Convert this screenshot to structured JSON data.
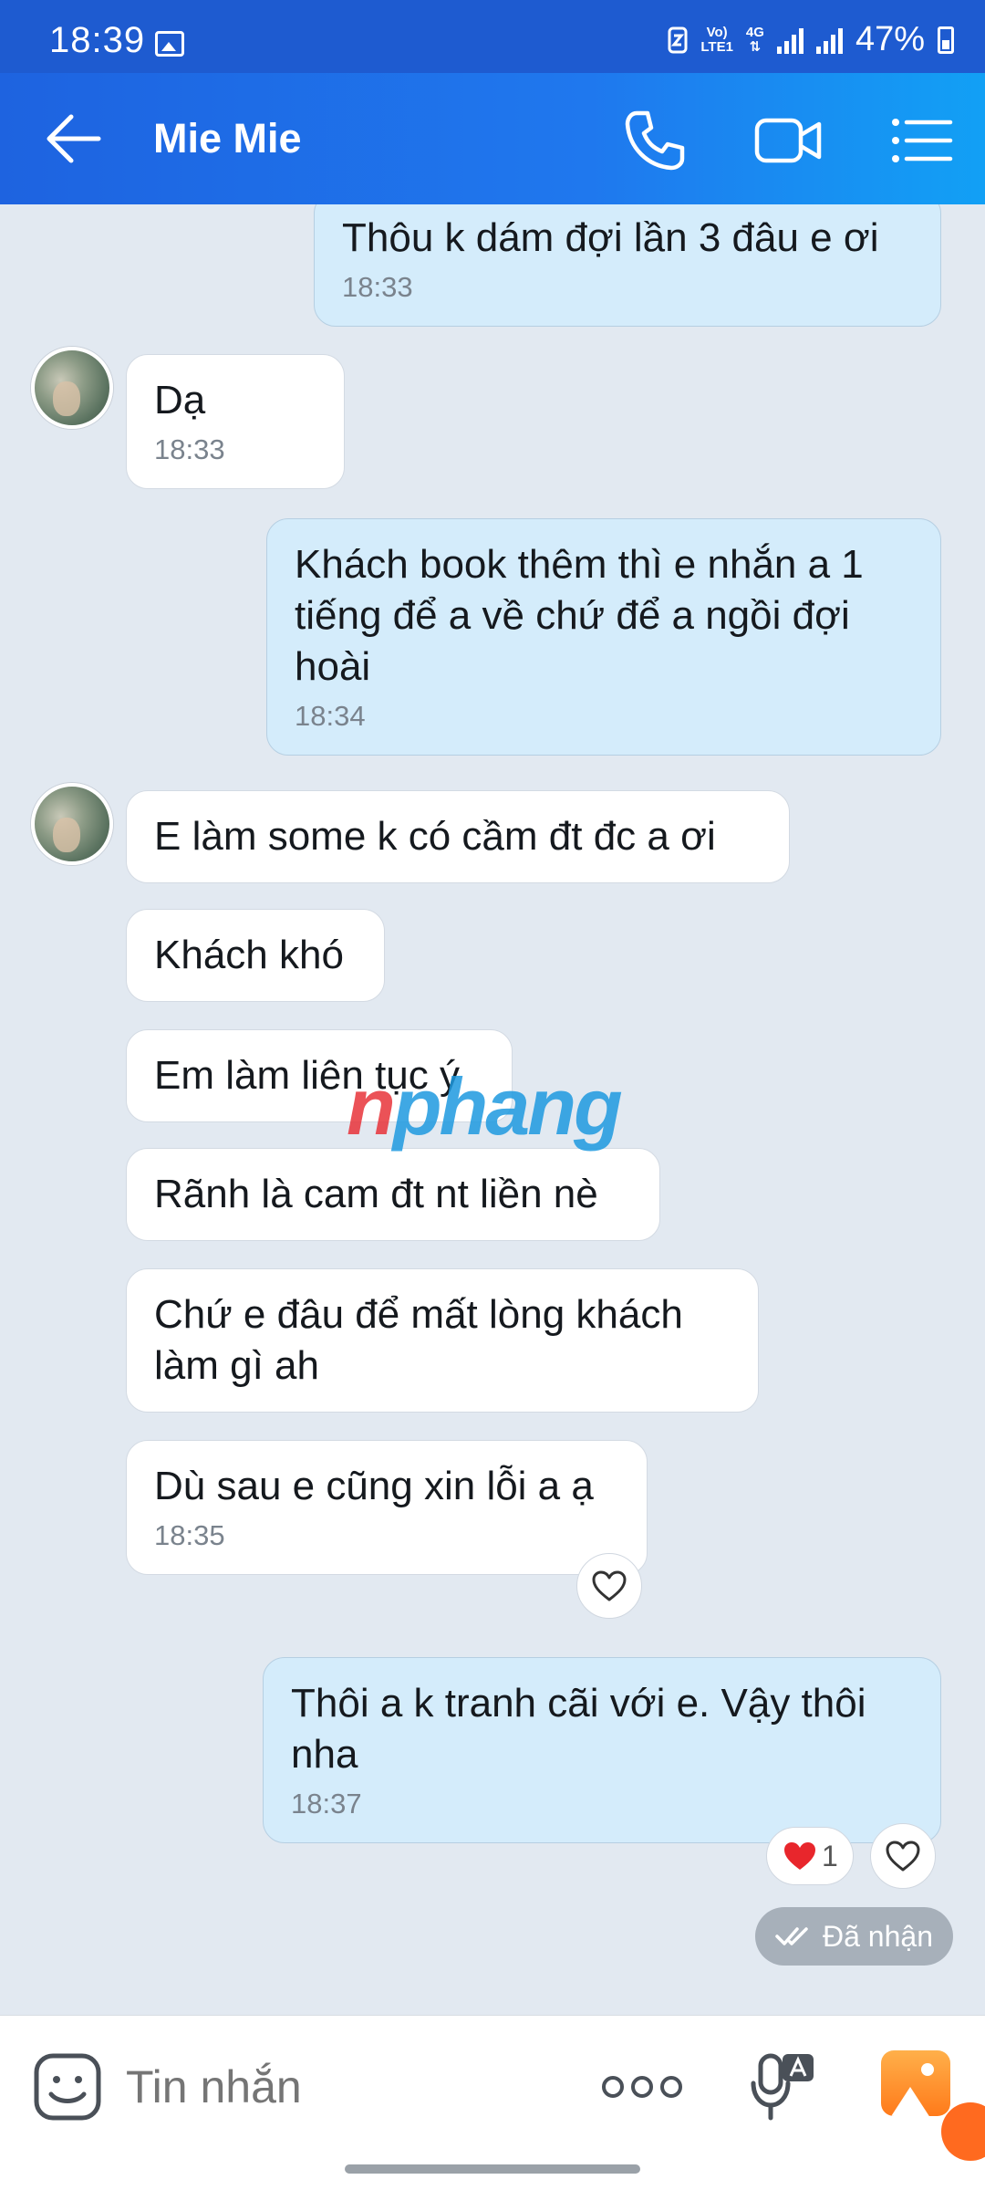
{
  "status_bar": {
    "time": "18:39",
    "net_top": "Vo)",
    "net_bottom": "LTE1",
    "net_type": "4G",
    "battery": "47%"
  },
  "header": {
    "title": "Mie Mie",
    "icons": [
      "back-arrow-icon",
      "phone-icon",
      "video-call-icon",
      "menu-list-icon"
    ],
    "gradient": [
      "#1e63e0",
      "#12a0f5"
    ]
  },
  "messages": [
    {
      "from": "me",
      "lines": "Thôu k dám đợi lần 3 đâu e ơi",
      "time": "18:33"
    },
    {
      "from": "them",
      "lines": "Dạ",
      "time": "18:33"
    },
    {
      "from": "me",
      "lines": "Khách book thêm thì e nhắn a 1 tiếng để a về chứ để a ngồi đợi hoài",
      "time": "18:34"
    },
    {
      "from": "them",
      "lines": "E làm some k có cầm đt đc a ơi",
      "time": ""
    },
    {
      "from": "them",
      "lines": "Khách khó",
      "time": ""
    },
    {
      "from": "them",
      "lines": "Em làm liên tục ý",
      "time": ""
    },
    {
      "from": "them",
      "lines": "Rãnh là cam đt nt liền nè",
      "time": ""
    },
    {
      "from": "them",
      "lines": "Chứ e đâu để mất lòng khách làm gì ah",
      "time": ""
    },
    {
      "from": "them",
      "lines": "Dù sau e cũng xin lỗi a ạ",
      "time": "18:35"
    },
    {
      "from": "me",
      "lines": "Thôi a k tranh cãi với e. Vậy thôi nha",
      "time": "18:37"
    }
  ],
  "reactions": {
    "heart_count": "1"
  },
  "delivery_status": "Đã nhận",
  "watermark": {
    "part1": "n",
    "part2": "phang"
  },
  "composer": {
    "placeholder": "Tin nhắn"
  },
  "colors": {
    "incoming_bubble": "#ffffff",
    "outgoing_bubble": "#d4ecfb",
    "chat_background": "#e2e9f1"
  }
}
